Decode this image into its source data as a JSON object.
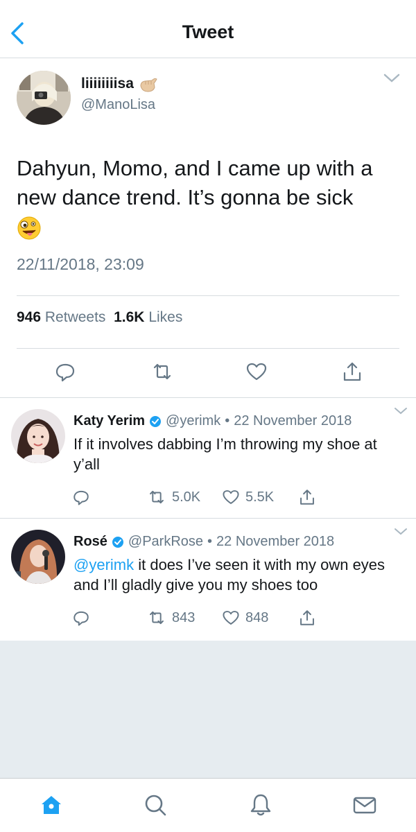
{
  "header": {
    "title": "Tweet"
  },
  "tweet": {
    "author_name": "liiiiiiiisa",
    "author_handle": "@ManoLisa",
    "text": "Dahyun, Momo, and I came up with a new dance trend. It’s gonna be sick",
    "timestamp": "22/11/2018, 23:09",
    "retweet_count": "946",
    "retweets_label": "Retweets",
    "like_count": "1.6K",
    "likes_label": "Likes"
  },
  "replies": [
    {
      "name": "Katy Yerim",
      "handle": "@yerimk",
      "date": "22 November 2018",
      "text": "If it involves dabbing I’m throwing my shoe at y’all",
      "retweets": "5.0K",
      "likes": "5.5K"
    },
    {
      "name": "Rosé",
      "handle": "@ParkRose",
      "date": "22 November 2018",
      "mention": "@yerimk",
      "text": " it does I’ve seen it with my own eyes and I’ll gladly give you my shoes too",
      "retweets": "843",
      "likes": "848"
    }
  ],
  "separator": "•",
  "icons": {
    "back": "chevron-left-icon",
    "caret": "chevron-down-icon",
    "reply": "speech-bubble-icon",
    "retweet": "retweet-icon",
    "like": "heart-icon",
    "share": "share-icon",
    "verified": "verified-badge-icon",
    "home": "home-icon",
    "search": "search-icon",
    "notifications": "bell-icon",
    "messages": "envelope-icon"
  },
  "colors": {
    "accent": "#1da1f2",
    "text": "#14171a",
    "secondary": "#657786",
    "divider": "#d7dce0",
    "background_gray": "#e6ecf0"
  }
}
